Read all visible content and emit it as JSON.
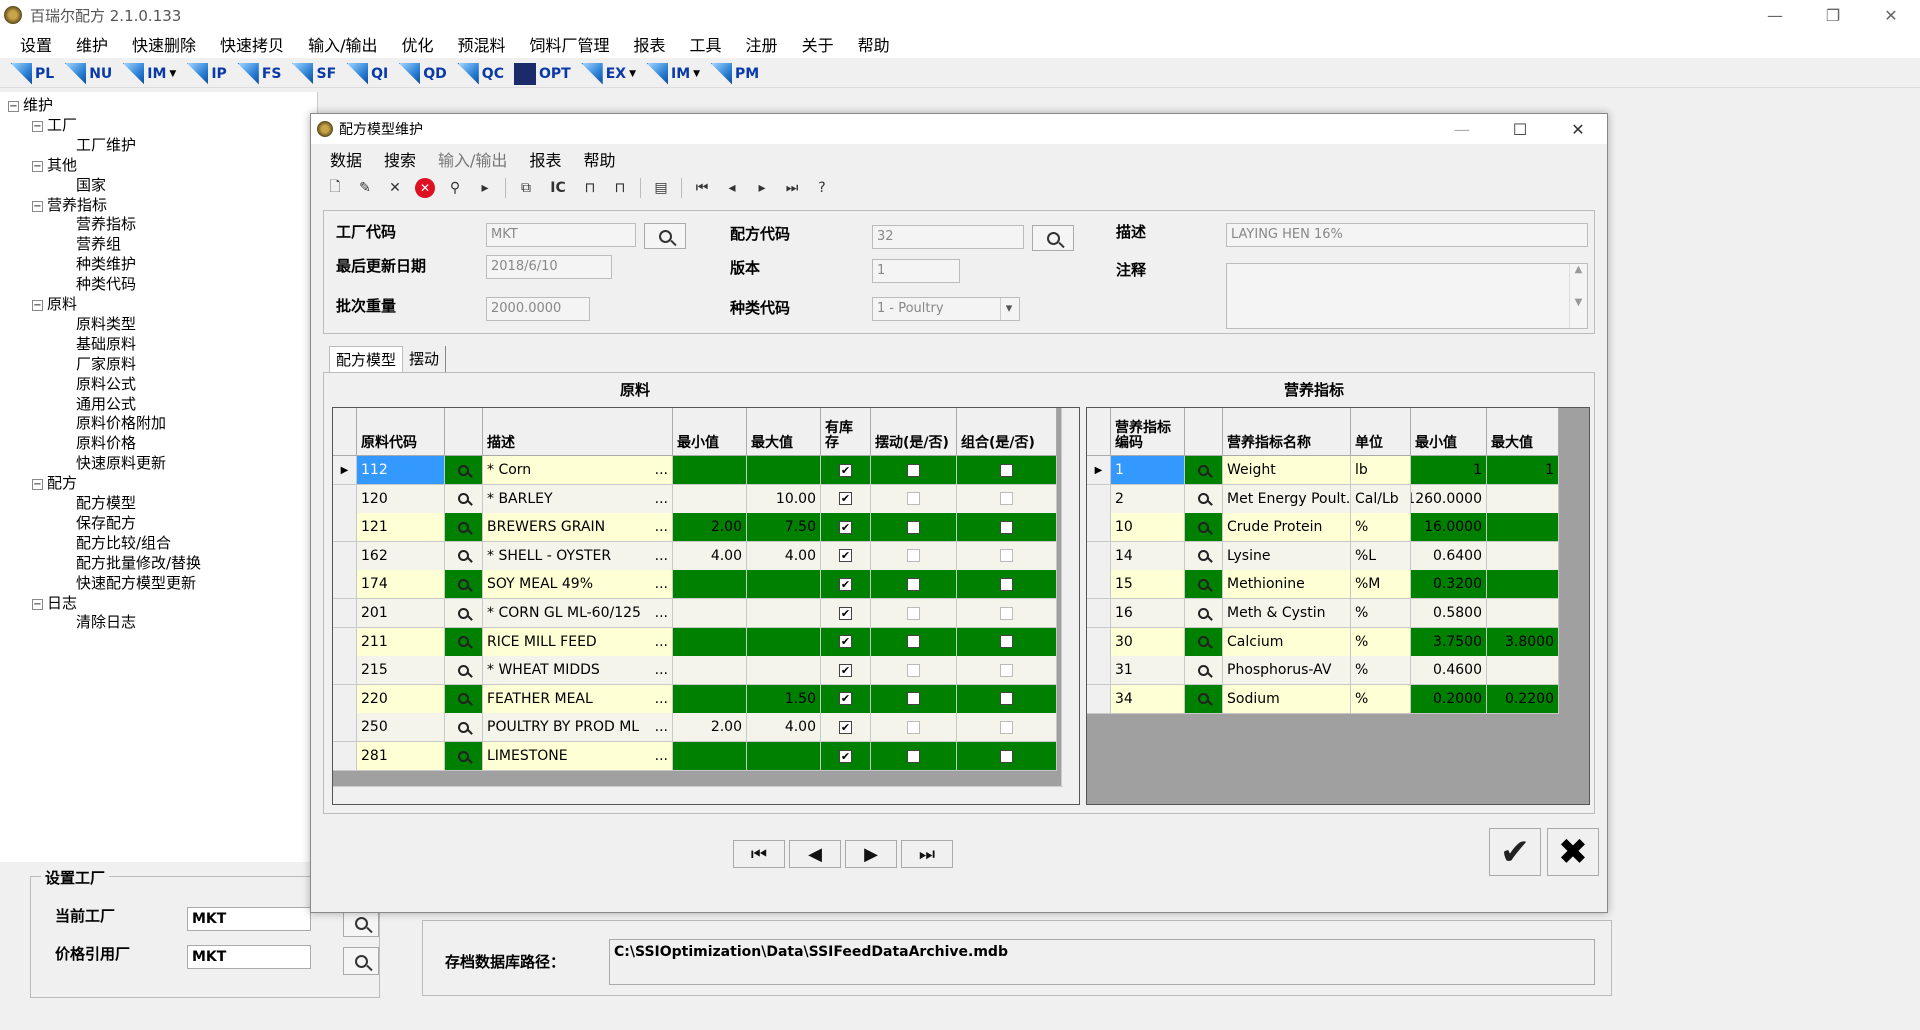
{
  "app": {
    "title": "百瑞尔配方 2.1.0.133"
  },
  "menu": [
    "设置",
    "维护",
    "快速删除",
    "快速拷贝",
    "输入/输出",
    "优化",
    "预混料",
    "饲料厂管理",
    "报表",
    "工具",
    "注册",
    "关于",
    "帮助"
  ],
  "toolbar": [
    {
      "label": "PL",
      "icon": "pl-icon"
    },
    {
      "label": "NU",
      "icon": "nu-icon"
    },
    {
      "label": "IM",
      "icon": "im-icon",
      "caret": true
    },
    {
      "label": "IP",
      "icon": "ip-icon"
    },
    {
      "label": "FS",
      "icon": "fs-icon"
    },
    {
      "label": "SF",
      "icon": "sf-icon"
    },
    {
      "label": "QI",
      "icon": "qi-icon"
    },
    {
      "label": "QD",
      "icon": "qd-icon"
    },
    {
      "label": "QC",
      "icon": "qc-icon"
    },
    {
      "label": "OPT",
      "icon": "opt-icon",
      "dark": true
    },
    {
      "label": "EX",
      "icon": "ex-icon",
      "caret": true
    },
    {
      "label": "IM",
      "icon": "import-icon",
      "caret": true
    },
    {
      "label": "PM",
      "icon": "pm-icon"
    }
  ],
  "tree": [
    {
      "label": "维护",
      "level": 0,
      "box": "−"
    },
    {
      "label": "工厂",
      "level": 1,
      "box": "−"
    },
    {
      "label": "工厂维护",
      "level": 2
    },
    {
      "label": "其他",
      "level": 1,
      "box": "−"
    },
    {
      "label": "国家",
      "level": 2
    },
    {
      "label": "营养指标",
      "level": 1,
      "box": "−"
    },
    {
      "label": "营养指标",
      "level": 2
    },
    {
      "label": "营养组",
      "level": 2
    },
    {
      "label": "种类维护",
      "level": 2
    },
    {
      "label": "种类代码",
      "level": 2
    },
    {
      "label": "原料",
      "level": 1,
      "box": "−"
    },
    {
      "label": "原料类型",
      "level": 2
    },
    {
      "label": "基础原料",
      "level": 2
    },
    {
      "label": "厂家原料",
      "level": 2
    },
    {
      "label": "原料公式",
      "level": 2
    },
    {
      "label": "通用公式",
      "level": 2
    },
    {
      "label": "原料价格附加",
      "level": 2
    },
    {
      "label": "原料价格",
      "level": 2
    },
    {
      "label": "快速原料更新",
      "level": 2
    },
    {
      "label": "配方",
      "level": 1,
      "box": "−"
    },
    {
      "label": "配方模型",
      "level": 2
    },
    {
      "label": "保存配方",
      "level": 2
    },
    {
      "label": "配方比较/组合",
      "level": 2
    },
    {
      "label": "配方批量修改/替换",
      "level": 2
    },
    {
      "label": "快速配方模型更新",
      "level": 2
    },
    {
      "label": "日志",
      "level": 1,
      "box": "−"
    },
    {
      "label": "清除日志",
      "level": 2
    }
  ],
  "factory": {
    "title": "设置工厂",
    "current_label": "当前工厂",
    "current_value": "MKT",
    "price_label": "价格引用厂",
    "price_value": "MKT"
  },
  "archive": {
    "label": "存档数据库路径：",
    "path": "C:\\SSIOptimization\\Data\\SSIFeedDataArchive.mdb"
  },
  "dialog": {
    "title": "配方模型维护",
    "menu": [
      {
        "label": "数据"
      },
      {
        "label": "搜索"
      },
      {
        "label": "输入/输出",
        "dim": true
      },
      {
        "label": "报表"
      },
      {
        "label": "帮助"
      }
    ],
    "header": {
      "plant_code_label": "工厂代码",
      "plant_code": "MKT",
      "last_update_label": "最后更新日期",
      "last_update": "2018/6/10",
      "batch_label": "批次重量",
      "batch": "2000.0000",
      "formula_code_label": "配方代码",
      "formula_code": "32",
      "version_label": "版本",
      "version": "1",
      "species_label": "种类代码",
      "species": "1 - Poultry",
      "desc_label": "描述",
      "desc": "LAYING HEN 16%",
      "notes_label": "注释"
    },
    "tabs": [
      "配方模型",
      "摆动"
    ],
    "ingredients": {
      "title": "原料",
      "columns": [
        "原料代码",
        "",
        "描述",
        "最小值",
        "最大值",
        "有库存",
        "摆动(是/否)",
        "组合(是/否)"
      ],
      "rows": [
        {
          "code": "112",
          "desc": "* Corn",
          "min": "",
          "max": "",
          "stock": true,
          "swing": false,
          "combo": false,
          "green": true,
          "selected": true
        },
        {
          "code": "120",
          "desc": "* BARLEY",
          "min": "",
          "max": "10.00",
          "stock": true,
          "swing": false,
          "combo": false,
          "green": false
        },
        {
          "code": "121",
          "desc": "BREWERS GRAIN",
          "min": "2.00",
          "max": "7.50",
          "stock": true,
          "swing": false,
          "combo": false,
          "green": true
        },
        {
          "code": "162",
          "desc": "* SHELL - OYSTER",
          "min": "4.00",
          "max": "4.00",
          "stock": true,
          "swing": false,
          "combo": false,
          "green": false
        },
        {
          "code": "174",
          "desc": "SOY MEAL 49%",
          "min": "",
          "max": "",
          "stock": true,
          "swing": false,
          "combo": false,
          "green": true
        },
        {
          "code": "201",
          "desc": "* CORN GL ML-60/125",
          "min": "",
          "max": "",
          "stock": true,
          "swing": false,
          "combo": false,
          "green": false
        },
        {
          "code": "211",
          "desc": "RICE MILL FEED",
          "min": "",
          "max": "",
          "stock": true,
          "swing": false,
          "combo": false,
          "green": true
        },
        {
          "code": "215",
          "desc": "* WHEAT MIDDS",
          "min": "",
          "max": "",
          "stock": true,
          "swing": false,
          "combo": false,
          "green": false
        },
        {
          "code": "220",
          "desc": "FEATHER MEAL",
          "min": "",
          "max": "1.50",
          "stock": true,
          "swing": false,
          "combo": false,
          "green": true
        },
        {
          "code": "250",
          "desc": "POULTRY BY PROD ML",
          "min": "2.00",
          "max": "4.00",
          "stock": true,
          "swing": false,
          "combo": false,
          "green": false
        },
        {
          "code": "281",
          "desc": "LIMESTONE",
          "min": "",
          "max": "",
          "stock": true,
          "swing": false,
          "combo": false,
          "green": true
        }
      ]
    },
    "nutrients": {
      "title": "营养指标",
      "columns": [
        "营养指标编码",
        "",
        "营养指标名称",
        "单位",
        "最小值",
        "最大值"
      ],
      "rows": [
        {
          "code": "1",
          "name": "Weight",
          "unit": "lb",
          "min": "1",
          "max": "1",
          "green": true,
          "selected": true
        },
        {
          "code": "2",
          "name": "Met Energy Poult...",
          "unit": "Cal/Lb",
          "min": "1260.0000",
          "max": "",
          "green": false
        },
        {
          "code": "10",
          "name": "Crude Protein",
          "unit": "%",
          "min": "16.0000",
          "max": "",
          "green": true
        },
        {
          "code": "14",
          "name": "Lysine",
          "unit": "%L",
          "min": "0.6400",
          "max": "",
          "green": false
        },
        {
          "code": "15",
          "name": "Methionine",
          "unit": "%M",
          "min": "0.3200",
          "max": "",
          "green": true
        },
        {
          "code": "16",
          "name": "Meth & Cystin",
          "unit": "%",
          "min": "0.5800",
          "max": "",
          "green": false
        },
        {
          "code": "30",
          "name": "Calcium",
          "unit": "%",
          "min": "3.7500",
          "max": "3.8000",
          "green": true
        },
        {
          "code": "31",
          "name": "Phosphorus-AV",
          "unit": "%",
          "min": "0.4600",
          "max": "",
          "green": false
        },
        {
          "code": "34",
          "name": "Sodium",
          "unit": "%",
          "min": "0.2000",
          "max": "0.2200",
          "green": true
        }
      ]
    }
  }
}
